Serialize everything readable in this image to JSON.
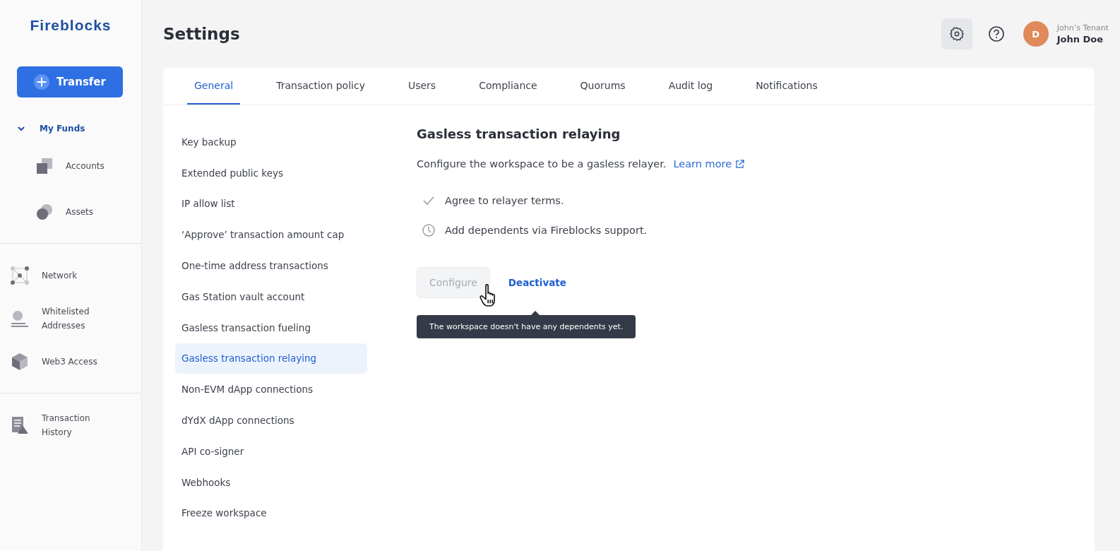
{
  "sidebar": {
    "logo": "Fireblocks",
    "transfer_button": "Transfer",
    "groups": [
      {
        "items": [
          {
            "label": "My Funds",
            "expanded": true,
            "children": [
              {
                "label": "Accounts"
              },
              {
                "label": "Assets"
              }
            ]
          }
        ]
      },
      {
        "items": [
          {
            "label": "Network"
          },
          {
            "label": "Whitelisted Addresses"
          },
          {
            "label": "Web3 Access"
          }
        ]
      },
      {
        "items": [
          {
            "label": "Transaction History"
          }
        ]
      }
    ]
  },
  "header": {
    "title": "Settings",
    "tenant": "John’s Tenant",
    "user": "John Doe",
    "avatar_initial": "D"
  },
  "tabs": [
    {
      "label": "General",
      "selected": true
    },
    {
      "label": "Transaction policy",
      "selected": false
    },
    {
      "label": "Users",
      "selected": false
    },
    {
      "label": "Compliance",
      "selected": false
    },
    {
      "label": "Quorums",
      "selected": false
    },
    {
      "label": "Audit log",
      "selected": false
    },
    {
      "label": "Notifications",
      "selected": false
    }
  ],
  "settings_menu": [
    {
      "label": "Key backup",
      "selected": false
    },
    {
      "label": "Extended public keys",
      "selected": false
    },
    {
      "label": "IP allow list",
      "selected": false
    },
    {
      "label": "‘Approve’ transaction amount cap",
      "selected": false
    },
    {
      "label": "One-time address transactions",
      "selected": false
    },
    {
      "label": "Gas Station vault account",
      "selected": false
    },
    {
      "label": "Gasless transaction fueling",
      "selected": false
    },
    {
      "label": "Gasless transaction relaying",
      "selected": true
    },
    {
      "label": "Non-EVM dApp connections",
      "selected": false
    },
    {
      "label": "dYdX dApp connections",
      "selected": false
    },
    {
      "label": "API co-signer",
      "selected": false
    },
    {
      "label": "Webhooks",
      "selected": false
    },
    {
      "label": "Freeze workspace",
      "selected": false
    }
  ],
  "panel": {
    "title": "Gasless transaction relaying",
    "description": "Configure the workspace to be a gasless relayer.",
    "learn_more": "Learn more",
    "steps": [
      {
        "kind": "done",
        "label": "Agree to relayer terms."
      },
      {
        "kind": "pending",
        "label": "Add dependents via Fireblocks support."
      }
    ],
    "configure_button": {
      "label": "Configure",
      "disabled": true
    },
    "deactivate_link": "Deactivate",
    "tooltip": "The workspace doesn't have any dependents yet."
  }
}
